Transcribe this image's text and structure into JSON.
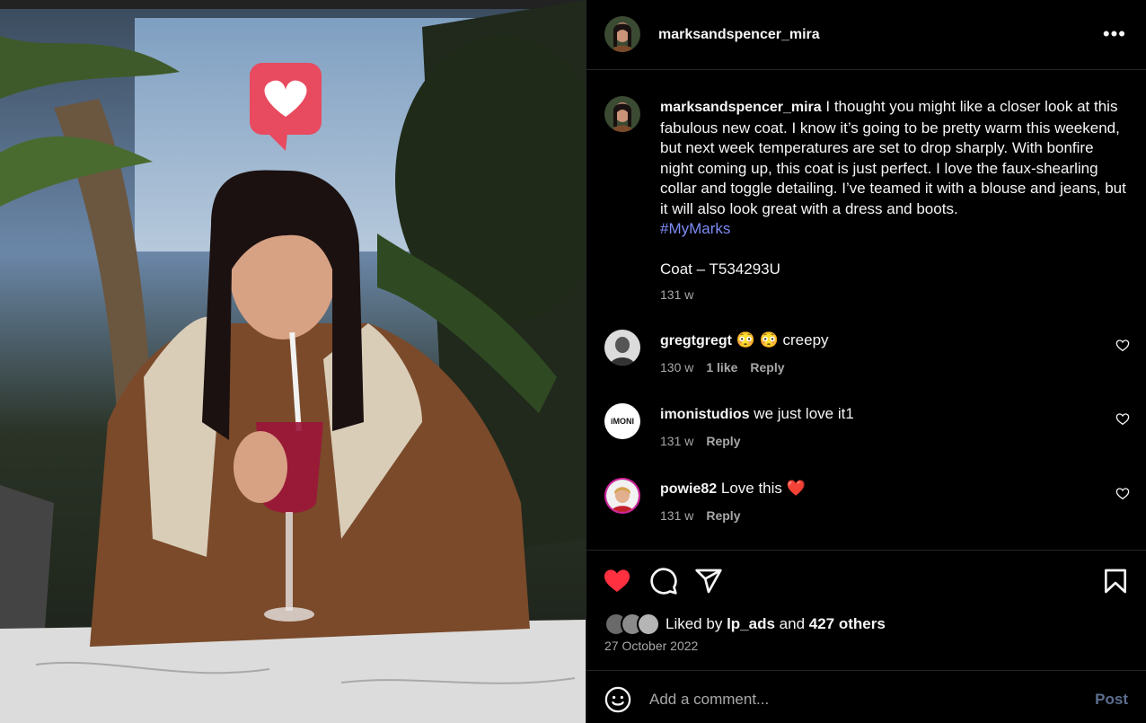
{
  "post": {
    "username": "marksandspencer_mira",
    "more_icon": "more-horizontal-icon",
    "caption_text": "I thought you might like a closer look at this fabulous new coat. I know it’s going to be pretty warm this weekend, but next week temperatures are set to drop sharply. With bonfire night coming up, this coat is just perfect. I love the faux-shearling collar and toggle detailing. I’ve teamed it with a blouse and jeans, but it will also look great with a dress and boots.",
    "hashtag": "#MyMarks",
    "product_line": "Coat – T534293U",
    "caption_time": "131 w"
  },
  "comments": [
    {
      "username": "gregtgregt",
      "text": "😳 😳 creepy",
      "time": "130 w",
      "likes": "1 like",
      "reply": "Reply"
    },
    {
      "username": "imonistudios",
      "text": "we just love it1",
      "time": "131 w",
      "likes": "",
      "reply": "Reply"
    },
    {
      "username": "powie82",
      "text": "Love this ❤️",
      "time": "131 w",
      "likes": "",
      "reply": "Reply"
    }
  ],
  "actions": {
    "liked_prefix": "Liked by",
    "liked_user": "lp_ads",
    "liked_and": "and",
    "liked_others": "427 others",
    "date": "27 October 2022",
    "like_color": "#ff3040"
  },
  "comment_bar": {
    "placeholder": "Add a comment...",
    "post_label": "Post"
  },
  "icons": [
    "heart-icon",
    "comment-icon",
    "share-icon",
    "save-icon",
    "emoji-icon"
  ]
}
